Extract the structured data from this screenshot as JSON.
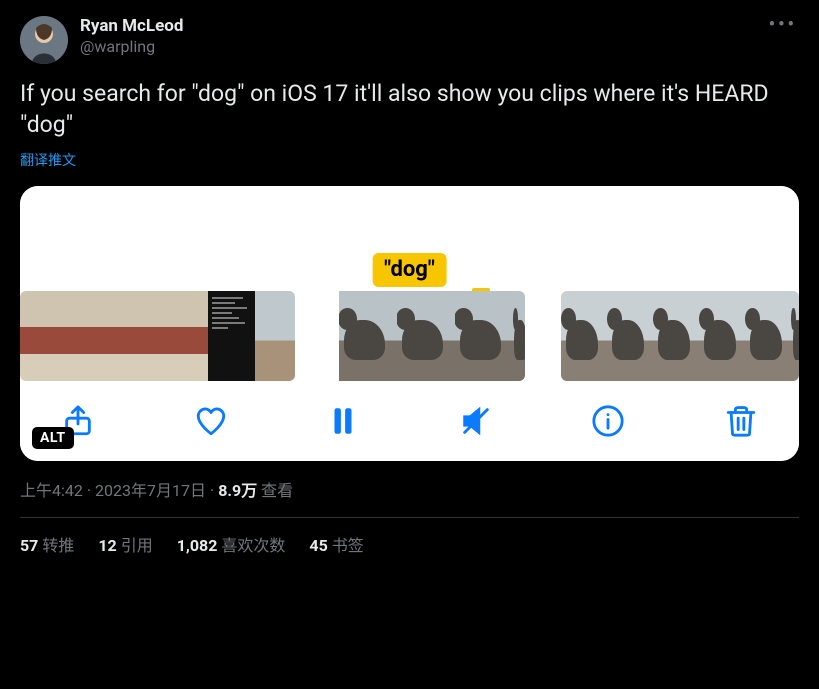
{
  "author": {
    "display_name": "Ryan McLeod",
    "handle": "@warpling"
  },
  "tweet_text": "If you search for \"dog\" on iOS 17 it'll also show you clips where it's HEARD \"dog\"",
  "translate_label": "翻译推文",
  "media": {
    "search_tag": "\"dog\"",
    "alt_badge": "ALT"
  },
  "timestamp": {
    "time": "上午4:42",
    "date": "2023年7月17日",
    "views_count": "8.9万",
    "views_label": "查看"
  },
  "stats": {
    "retweets": {
      "count": "57",
      "label": "转推"
    },
    "quotes": {
      "count": "12",
      "label": "引用"
    },
    "likes": {
      "count": "1,082",
      "label": "喜欢次数"
    },
    "bookmarks": {
      "count": "45",
      "label": "书签"
    }
  }
}
